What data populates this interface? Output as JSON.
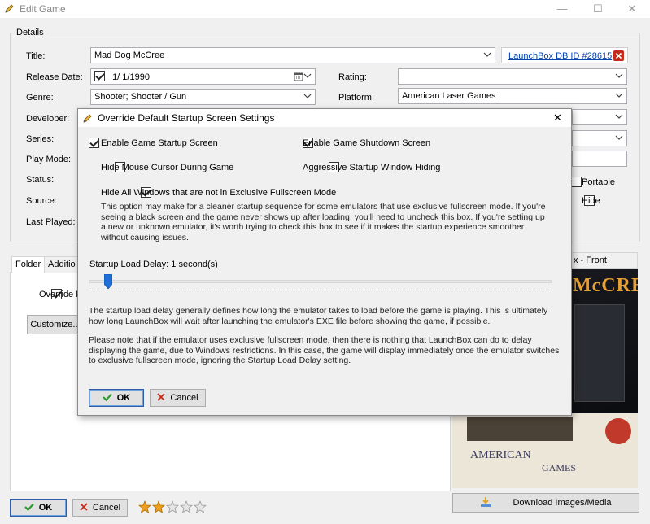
{
  "window": {
    "title": "Edit Game",
    "controls": {
      "minimize": "—",
      "maximize": "☐",
      "close": "✕"
    }
  },
  "details": {
    "group_label": "Details",
    "title_label": "Title:",
    "title_value": "Mad Dog McCree",
    "db_link": "LaunchBox DB ID #28615",
    "release_label": "Release Date:",
    "release_value": "1/  1/1990",
    "rating_label": "Rating:",
    "rating_value": "",
    "genre_label": "Genre:",
    "genre_value": "Shooter; Shooter / Gun",
    "platform_label": "Platform:",
    "platform_value": "American Laser Games",
    "developer_label": "Developer:",
    "series_label": "Series:",
    "playmode_label": "Play Mode:",
    "status_label": "Status:",
    "source_label": "Source:",
    "lastplayed_label": "Last Played:",
    "portable_label": "Portable",
    "hide_label": "Hide"
  },
  "tabs": {
    "folder": "Folder",
    "additional": "Additio"
  },
  "left_panel": {
    "override_label": "Override D",
    "customize_label": "Customize..."
  },
  "image_panel": {
    "header": "x - Front",
    "download_label": "Download Images/Media"
  },
  "footer": {
    "ok_label": "OK",
    "cancel_label": "Cancel",
    "rating_stars": 2,
    "rating_max": 5
  },
  "dialog": {
    "title": "Override Default Startup Screen Settings",
    "close": "✕",
    "opt_startup": "Enable Game Startup Screen",
    "opt_shutdown": "Enable Game Shutdown Screen",
    "opt_hide_cursor": "Hide Mouse Cursor During Game",
    "opt_aggressive": "Aggressive Startup Window Hiding",
    "opt_hide_windows": "Hide All Windows that are not in Exclusive Fullscreen Mode",
    "hide_windows_desc": "This option may make for a cleaner startup sequence for some emulators that use exclusive fullscreen mode. If you're seeing a black screen and the game never shows up after loading, you'll need to uncheck this box. If you're setting up a new or unknown emulator, it's worth trying to check this box to see if it makes the startup experience smoother without causing issues.",
    "delay_label": "Startup Load Delay: ",
    "delay_value": "1 second(s)",
    "delay_seconds": 1,
    "delay_desc1": "The startup load delay generally defines how long the emulator takes to load before the game is playing. This is ultimately how long LaunchBox will wait after launching the emulator's EXE file before showing the game, if possible.",
    "delay_desc2": "Please note that if the emulator uses exclusive fullscreen mode, then there is nothing that LaunchBox can do to delay displaying the game, due to Windows restrictions. In this case, the game will display immediately once the emulator switches to exclusive fullscreen mode, ignoring the Startup Load Delay setting.",
    "ok_label": "OK",
    "cancel_label": "Cancel",
    "checked": {
      "startup": true,
      "shutdown": true,
      "hide_cursor": false,
      "aggressive": false,
      "hide_windows": true
    }
  },
  "cover": {
    "title_text": "McCREE",
    "brand_text": "AMERICAN",
    "brand_sub": "GAMES"
  },
  "colors": {
    "accent": "#2d5ea8",
    "link": "#0645ad",
    "close_red": "#c42b1c",
    "ok_green": "#2e9b2e"
  }
}
